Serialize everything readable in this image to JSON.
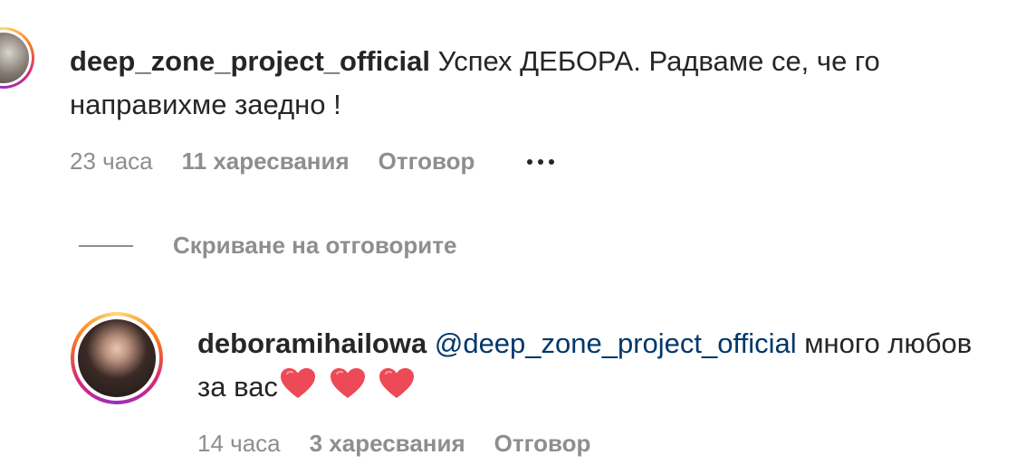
{
  "comments": [
    {
      "username": "deep_zone_project_official",
      "text": "Успех ДЕБОРА. Радваме се, че го направихме заедно !",
      "time": "23 часа",
      "likes": "11 харесвания",
      "reply_label": "Отговор"
    }
  ],
  "replies_toggle": {
    "label": "Скриване на отговорите"
  },
  "replies": [
    {
      "username": "deboramihailowa",
      "mention": "@deep_zone_project_official",
      "text": "много любов за вас",
      "time": "14 часа",
      "likes": "3 харесвания",
      "reply_label": "Отговор"
    }
  ],
  "colors": {
    "text": "#262626",
    "muted": "#8e8e8e",
    "mention": "#00376b",
    "heart": "#ed4956"
  },
  "icons": {
    "more_options": "more-options-icon",
    "heart_emoji": "heart-emoji-icon",
    "heart_emoji_count": 3
  }
}
